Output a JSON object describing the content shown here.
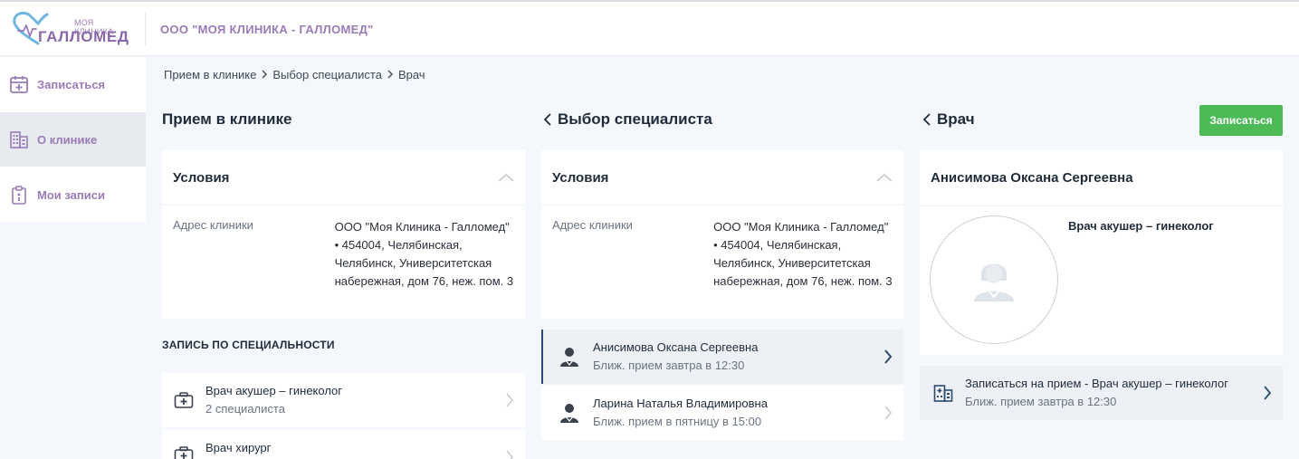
{
  "brand": {
    "logo_small": "МОЯ КЛИНИКА",
    "logo_big": "ГАЛЛОМЕД",
    "org_name": "ООО \"МОЯ КЛИНИКА - ГАЛЛОМЕД\"",
    "accent_color": "#9a7bb8"
  },
  "sidebar": {
    "items": [
      {
        "label": "Записаться",
        "icon": "calendar-plus-icon",
        "active": false
      },
      {
        "label": "О клинике",
        "icon": "building-icon",
        "active": true
      },
      {
        "label": "Мои записи",
        "icon": "clipboard-icon",
        "active": false
      }
    ]
  },
  "breadcrumb": [
    "Прием в клинике",
    "Выбор специалиста",
    "Врач"
  ],
  "col1": {
    "title": "Прием в клинике",
    "conditions_title": "Условия",
    "address_label": "Адрес клиники",
    "address_value": "ООО \"Моя Клиника - Галломед\" • 454004, Челябинская, Челябинск, Университетская набережная, дом 76, неж. пом. 3",
    "section_caption": "ЗАПИСЬ ПО СПЕЦИАЛЬНОСТИ",
    "specialties": [
      {
        "title": "Врач акушер – гинеколог",
        "subtitle": "2 специалиста",
        "icon": "medkit-icon"
      },
      {
        "title": "Врач хирург",
        "subtitle": "",
        "icon": "medkit-icon"
      }
    ]
  },
  "col2": {
    "title": "Выбор специалиста",
    "conditions_title": "Условия",
    "address_label": "Адрес клиники",
    "address_value": "ООО \"Моя Клиника - Галломед\" • 454004, Челябинская, Челябинск, Университетская набережная, дом 76, неж. пом. 3",
    "doctors": [
      {
        "name": "Анисимова Оксана Сергеевна",
        "next": "Ближ. прием завтра в 12:30",
        "selected": true
      },
      {
        "name": "Ларина Наталья Владимировна",
        "next": "Ближ. прием в пятницу в 15:00",
        "selected": false
      }
    ]
  },
  "col3": {
    "title": "Врач",
    "book_button": "Записаться",
    "doctor_name": "Анисимова Оксана Сергеевна",
    "doctor_specialty": "Врач акушер – гинеколог",
    "appointment_title": "Записаться на прием - Врач акушер – гинеколог",
    "appointment_next": "Ближ. прием завтра в 12:30",
    "button_color": "#4cba57"
  }
}
